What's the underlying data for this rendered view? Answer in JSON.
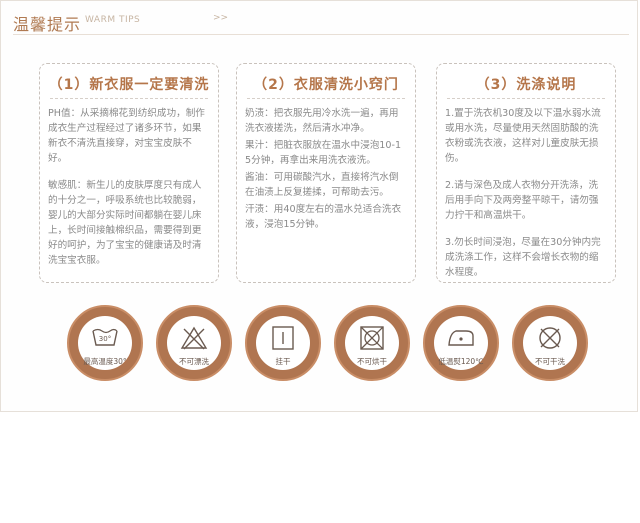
{
  "header": {
    "title": "温馨提示",
    "subtitle": "WARM TIPS",
    "arrow": ">>"
  },
  "cards": [
    {
      "title": "（1）新衣服一定要清洗",
      "paragraphs": [
        "PH值：从采摘棉花到纺织成功，制作成衣生产过程经过了诸多环节，如果新衣不清洗直接穿，对宝宝皮肤不好。",
        "敏感肌：新生儿的皮肤厚度只有成人的十分之一，呼吸系统也比较脆弱，婴儿的大部分实际时间都躺在婴儿床上，长时间接触棉织品，需要得到更好的呵护，为了宝宝的健康请及时清洗宝宝衣服。"
      ]
    },
    {
      "title": "（2）衣服清洗小窍门",
      "paragraphs": [
        "奶渍：把衣服先用冷水洗一遍，再用洗衣液搓洗，然后清水冲净。",
        "果汁：把脏衣服放在温水中浸泡10-15分钟，再拿出来用洗衣液洗。",
        "酱油：可用碳酸汽水，直接将汽水倒在油渍上反复搓揉，可帮助去污。",
        "汗渍：用40度左右的温水兑适合洗衣液，浸泡15分钟。"
      ]
    },
    {
      "title": "（3）洗涤说明",
      "paragraphs": [
        "1.置于洗衣机30度及以下温水弱水流或用水洗，尽量使用天然固肪酸的洗衣粉或洗衣液，这样对儿童皮肤无损伤。",
        "2.请与深色及成人衣物分开洗涤，洗后用手向下及两旁整平晾干，请勿强力拧干和高温烘干。",
        "3.勿长时间浸泡，尽量在30分钟内完成洗涤工作，这样不会增长衣物的缩水程度。"
      ]
    }
  ],
  "icons": [
    {
      "name": "wash-30-icon",
      "label": "最高温度30°",
      "mark": "30°"
    },
    {
      "name": "no-bleach-icon",
      "label": "不可漂洗"
    },
    {
      "name": "hang-dry-icon",
      "label": "挂干"
    },
    {
      "name": "no-tumble-dry-icon",
      "label": "不可烘干"
    },
    {
      "name": "low-iron-icon",
      "label": "低温熨120℃"
    },
    {
      "name": "no-dry-clean-icon",
      "label": "不可干洗"
    }
  ]
}
